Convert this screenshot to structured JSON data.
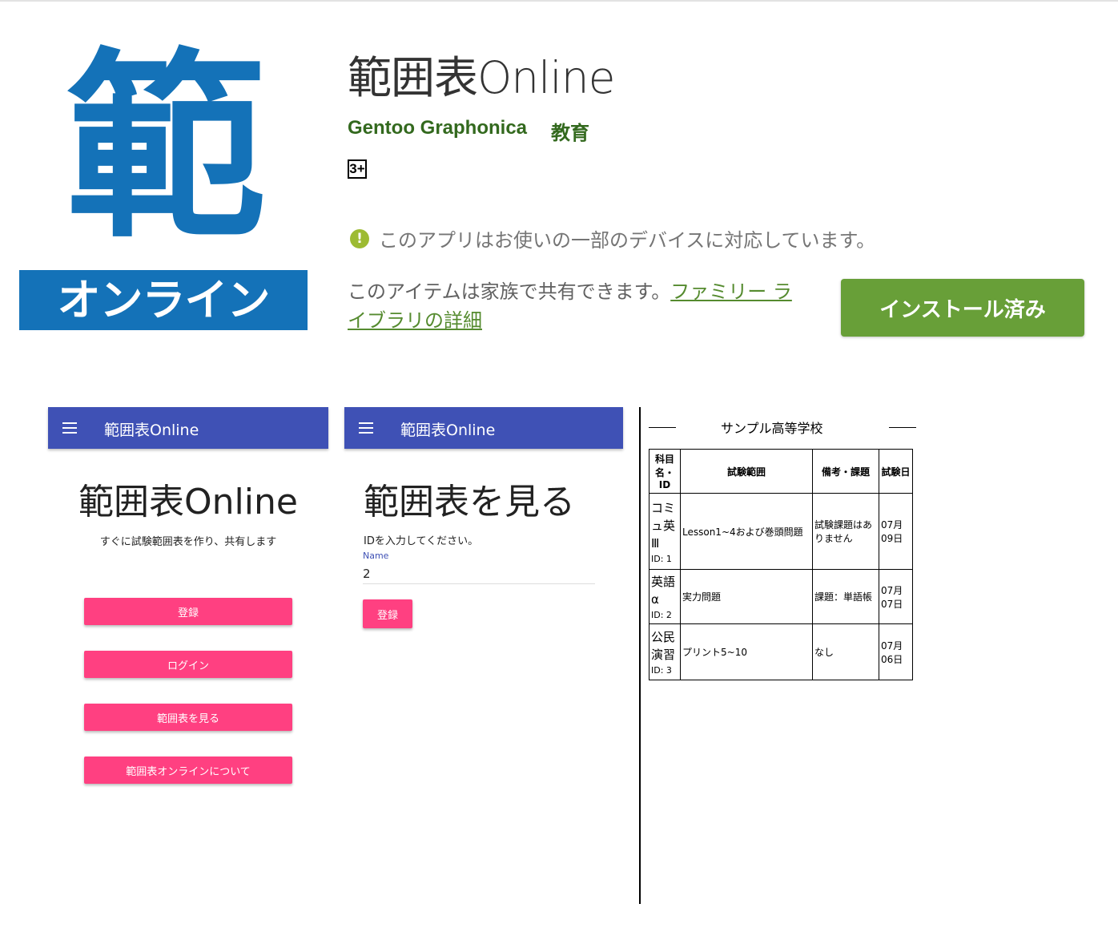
{
  "app": {
    "icon": {
      "kanji": "範",
      "band_text": "オンライン",
      "color": "#1472b8"
    },
    "title": "範囲表Online",
    "developer": "Gentoo Graphonica",
    "category": "教育",
    "content_rating": "3+",
    "compat_notice": "このアプリはお使いの一部のデバイスに対応しています。",
    "family_text": "このアイテムは家族で共有できます。",
    "family_link": "ファミリー ライブラリの詳細",
    "install_label": "インストール済み",
    "install_color": "#689f38"
  },
  "screenshots": {
    "s1": {
      "appbar_title": "範囲表Online",
      "heading": "範囲表Online",
      "subtitle": "すぐに試験範囲表を作り、共有します",
      "buttons": [
        "登録",
        "ログイン",
        "範囲表を見る",
        "範囲表オンラインについて"
      ]
    },
    "s2": {
      "appbar_title": "範囲表Online",
      "heading": "範囲表を見る",
      "prompt": "IDを入力してください。",
      "field_label": "Name",
      "field_value": "2",
      "button": "登録"
    },
    "s3": {
      "school": "サンプル高等学校",
      "headers": [
        "科目名・ID",
        "試験範囲",
        "備考・課題",
        "試験日"
      ],
      "rows": [
        {
          "subject": "コミュ英Ⅲ",
          "id": "ID: 1",
          "range": "Lesson1~4および巻頭問題",
          "note": "試験課題はありません",
          "date": "07月09日"
        },
        {
          "subject": "英語α",
          "id": "ID: 2",
          "range": "実力問題",
          "note": "課題：単語帳",
          "date": "07月07日"
        },
        {
          "subject": "公民演習",
          "id": "ID: 3",
          "range": "プリント5~10",
          "note": "なし",
          "date": "07月06日"
        }
      ]
    }
  },
  "colors": {
    "appbar": "#3f51b5",
    "accent_button": "#ff4081",
    "developer": "#33691e"
  }
}
